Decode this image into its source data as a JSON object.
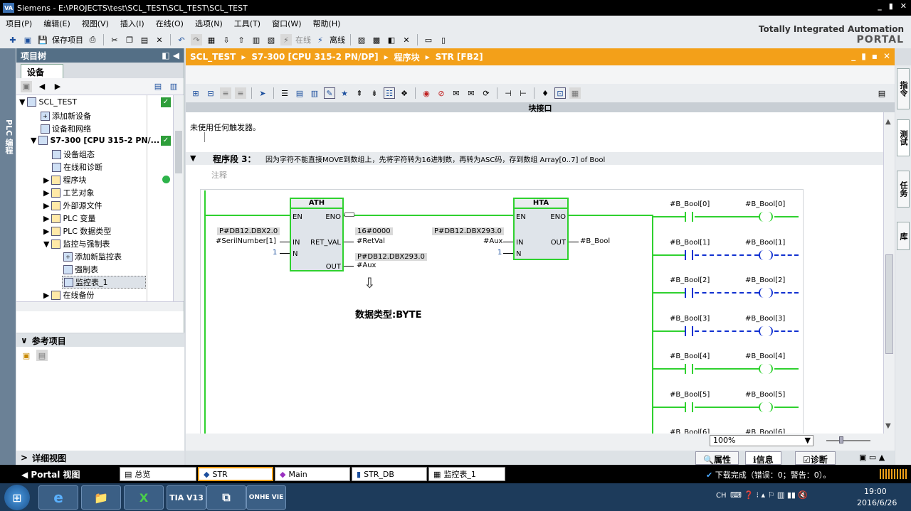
{
  "window": {
    "title": "Siemens - E:\\PROJECTS\\test\\SCL_TEST\\SCL_TEST\\SCL_TEST",
    "logo": "VA",
    "controls": [
      "_",
      "▮",
      "✕"
    ]
  },
  "menu": [
    "项目(P)",
    "编辑(E)",
    "视图(V)",
    "插入(I)",
    "在线(O)",
    "选项(N)",
    "工具(T)",
    "窗口(W)",
    "帮助(H)"
  ],
  "toolbar": {
    "save_label": "保存项目",
    "online": "在线",
    "offline": "离线"
  },
  "portal": {
    "line1": "Totally Integrated Automation",
    "line2": "PORTAL"
  },
  "left_tab": "PLC 编程",
  "project_tree": {
    "title": "项目树",
    "tab": "设备",
    "items": [
      {
        "label": "SCL_TEST"
      },
      {
        "label": "添加新设备"
      },
      {
        "label": "设备和网络"
      },
      {
        "label": "S7-300 [CPU 315-2 PN/..."
      },
      {
        "label": "设备组态"
      },
      {
        "label": "在线和诊断"
      },
      {
        "label": "程序块"
      },
      {
        "label": "工艺对象"
      },
      {
        "label": "外部源文件"
      },
      {
        "label": "PLC 变量"
      },
      {
        "label": "PLC 数据类型"
      },
      {
        "label": "监控与强制表"
      },
      {
        "label": "添加新监控表"
      },
      {
        "label": "强制表"
      },
      {
        "label": "监控表_1"
      },
      {
        "label": "在线备份"
      }
    ]
  },
  "reference": {
    "title": "参考项目"
  },
  "detail": {
    "title": "详细视图"
  },
  "editor": {
    "breadcrumb": [
      "SCL_TEST",
      "S7-300 [CPU 315-2 PN/DP]",
      "程序块",
      "STR [FB2]"
    ],
    "interface_label": "块接口",
    "trigger_text": "未使用任何触发器。",
    "network_title": "程序段 3：",
    "network_desc": "因为字符不能直接MOVE到数组上，先将字符转为16进制数，再转为ASC码，存到数组 Array[0..7] of Bool",
    "comment": "注释",
    "ath": {
      "title": "ATH",
      "en": "EN",
      "eno": "ENO",
      "in": "IN",
      "retval": "RET_VAL",
      "n": "N",
      "out": "OUT",
      "in_addr": "P#DB12.DBX2.0",
      "in_var": "#SerilNumber[1]",
      "n_val": "1",
      "retval_val": "16#0000",
      "retval_var": "#RetVal",
      "out_addr": "P#DB12.DBX293.0",
      "out_var": "#Aux"
    },
    "hta": {
      "title": "HTA",
      "en": "EN",
      "eno": "ENO",
      "in": "IN",
      "out": "OUT",
      "n": "N",
      "in_addr": "P#DB12.DBX293.0",
      "in_var": "#Aux",
      "n_val": "1",
      "out_var": "#B_Bool"
    },
    "annotation": "数据类型:BYTE",
    "contacts": [
      {
        "contact": "#B_Bool[0]",
        "coil": "#B_Bool[0]",
        "state": "on"
      },
      {
        "contact": "#B_Bool[1]",
        "coil": "#B_Bool[1]",
        "state": "off"
      },
      {
        "contact": "#B_Bool[2]",
        "coil": "#B_Bool[2]",
        "state": "off"
      },
      {
        "contact": "#B_Bool[3]",
        "coil": "#B_Bool[3]",
        "state": "off"
      },
      {
        "contact": "#B_Bool[4]",
        "coil": "#B_Bool[4]",
        "state": "on"
      },
      {
        "contact": "#B_Bool[5]",
        "coil": "#B_Bool[5]",
        "state": "on"
      },
      {
        "contact": "#B_Bool[6]",
        "coil": "#B_Bool[6]",
        "state": "on"
      }
    ],
    "zoom": "100%"
  },
  "right_tabs": [
    "指令",
    "测试",
    "任务",
    "库"
  ],
  "prop_tabs": {
    "properties": "属性",
    "info": "信息",
    "diagnostics": "诊断"
  },
  "portal_bar": {
    "portal_view": "Portal 视图",
    "tasks": [
      "总览",
      "STR",
      "Main",
      "STR_DB",
      "监控表_1"
    ],
    "status": "下载完成（错误：0；警告：0）。"
  },
  "taskbar": {
    "apps": [
      "e",
      "📁",
      "X",
      "TIA V13",
      "⧉",
      "ONHE VIE"
    ],
    "lang": "CH",
    "time": "19:00",
    "date": "2016/6/26"
  },
  "colors": {
    "accent": "#f3a019",
    "panel": "#546f86",
    "powerflow": "#2fd12f",
    "nopower": "#1030d0"
  }
}
